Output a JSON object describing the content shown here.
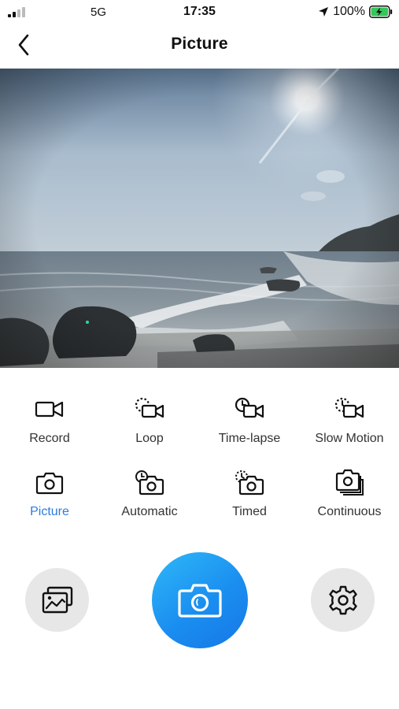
{
  "status_bar": {
    "carrier": "5G",
    "time": "17:35",
    "battery": "100%",
    "icons": [
      "signal-icon",
      "location-icon",
      "battery-charging-icon"
    ]
  },
  "header": {
    "title": "Picture",
    "back_icon": "chevron-left-icon"
  },
  "preview": {
    "description_icon": "camera-preview-image"
  },
  "modes": [
    {
      "label": "Record",
      "icon": "video-icon",
      "active": false
    },
    {
      "label": "Loop",
      "icon": "loop-video-icon",
      "active": false
    },
    {
      "label": "Time-lapse",
      "icon": "time-lapse-video-icon",
      "active": false
    },
    {
      "label": "Slow Motion",
      "icon": "slow-motion-video-icon",
      "active": false
    },
    {
      "label": "Picture",
      "icon": "camera-icon",
      "active": true
    },
    {
      "label": "Automatic",
      "icon": "automatic-camera-icon",
      "active": false
    },
    {
      "label": "Timed",
      "icon": "timed-camera-icon",
      "active": false
    },
    {
      "label": "Continuous",
      "icon": "continuous-camera-icon",
      "active": false
    }
  ],
  "controls": {
    "gallery_icon": "gallery-icon",
    "shutter_icon": "camera-shutter-icon",
    "settings_icon": "gear-icon"
  },
  "colors": {
    "accent": "#2d7be0",
    "shutter_gradient_start": "#2fb8f8",
    "shutter_gradient_end": "#1677e6",
    "button_bg": "#e7e7e7"
  }
}
